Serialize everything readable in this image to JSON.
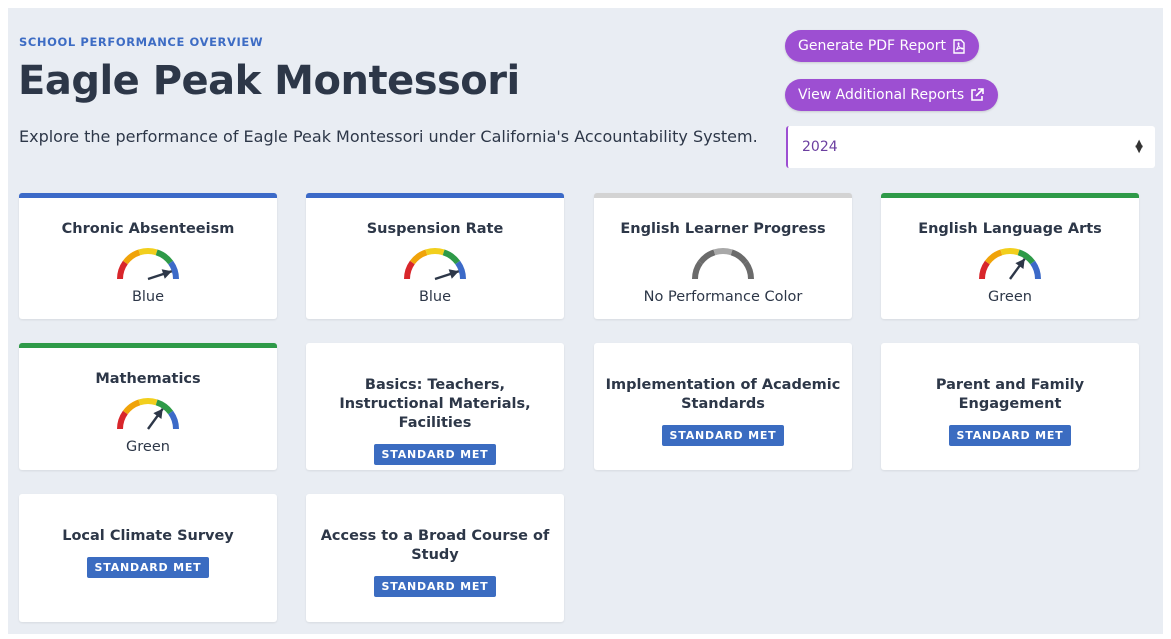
{
  "header": {
    "eyebrow": "SCHOOL PERFORMANCE OVERVIEW",
    "title": "Eagle Peak Montessori",
    "subtitle": "Explore the performance of Eagle Peak Montessori under California's Accountability System."
  },
  "actions": {
    "pdf_label": "Generate PDF Report",
    "pdf_icon": "pdf-file-icon",
    "more_label": "View Additional Reports",
    "more_icon": "external-link-icon"
  },
  "year_select": {
    "value": "2024"
  },
  "colors": {
    "accent": "#9d4fd2",
    "blue": "#3c6ac8",
    "green": "#2e9a48",
    "badge": "#3b6cc1"
  },
  "indicators": [
    {
      "title": "Chronic Absenteeism",
      "level": "Blue"
    },
    {
      "title": "Suspension Rate",
      "level": "Blue"
    },
    {
      "title": "English Learner Progress",
      "level": "No Performance Color"
    },
    {
      "title": "English Language Arts",
      "level": "Green"
    },
    {
      "title": "Mathematics",
      "level": "Green"
    }
  ],
  "local_indicators": [
    {
      "title": "Basics: Teachers, Instructional Materials, Facilities",
      "status": "STANDARD MET"
    },
    {
      "title": "Implementation of Academic Standards",
      "status": "STANDARD MET"
    },
    {
      "title": "Parent and Family Engagement",
      "status": "STANDARD MET"
    },
    {
      "title": "Local Climate Survey",
      "status": "STANDARD MET"
    },
    {
      "title": "Access to a Broad Course of Study",
      "status": "STANDARD MET"
    }
  ]
}
